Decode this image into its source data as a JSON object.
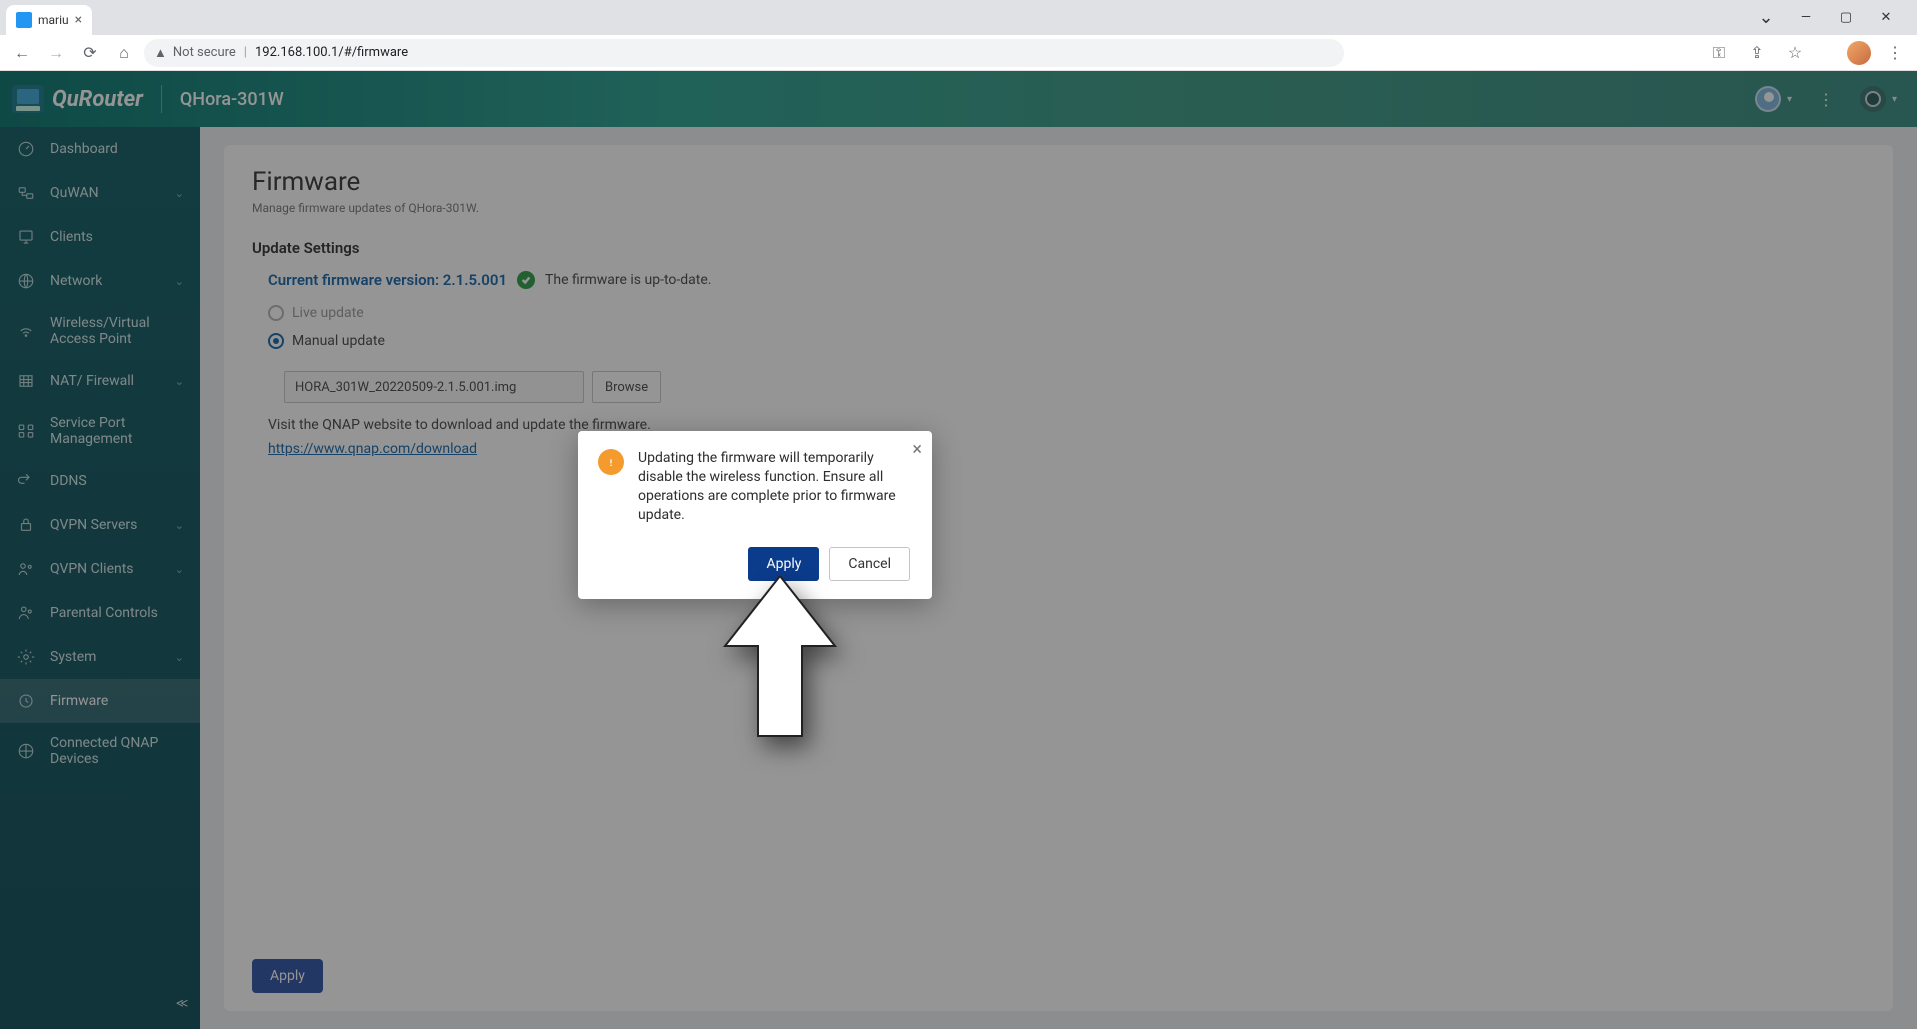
{
  "browser": {
    "tab_title": "mariu",
    "security_label": "Not secure",
    "url": "192.168.100.1/#/firmware"
  },
  "header": {
    "brand": "QuRouter",
    "model": "QHora-301W"
  },
  "sidebar": {
    "items": [
      {
        "label": "Dashboard"
      },
      {
        "label": "QuWAN",
        "expandable": true
      },
      {
        "label": "Clients"
      },
      {
        "label": "Network",
        "expandable": true
      },
      {
        "label": "Wireless/Virtual Access Point"
      },
      {
        "label": "NAT/ Firewall",
        "expandable": true
      },
      {
        "label": "Service Port Management"
      },
      {
        "label": "DDNS"
      },
      {
        "label": "QVPN Servers",
        "expandable": true
      },
      {
        "label": "QVPN Clients",
        "expandable": true
      },
      {
        "label": "Parental Controls"
      },
      {
        "label": "System",
        "expandable": true
      },
      {
        "label": "Firmware",
        "active": true
      },
      {
        "label": "Connected QNAP Devices"
      }
    ]
  },
  "page": {
    "title": "Firmware",
    "subtitle": "Manage firmware updates of QHora-301W.",
    "section_header": "Update Settings",
    "version_label": "Current firmware version: 2.1.5.001",
    "status_text": "The firmware is up-to-date.",
    "radio_live": "Live update",
    "radio_manual": "Manual update",
    "file_value": "HORA_301W_20220509-2.1.5.001.img",
    "browse_label": "Browse",
    "help_prefix": "Visit the QNAP website to download and update the firmware.",
    "help_link": "https://www.qnap.com/download",
    "apply_label": "Apply"
  },
  "dialog": {
    "message": "Updating the firmware will temporarily disable the wireless function. Ensure all operations are complete prior to firmware update.",
    "apply": "Apply",
    "cancel": "Cancel"
  }
}
